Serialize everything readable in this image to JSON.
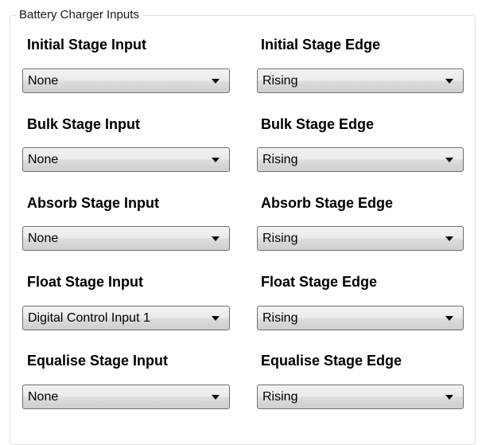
{
  "group": {
    "title": "Battery Charger Inputs"
  },
  "rows": [
    {
      "input_label": "Initial Stage Input",
      "input_value": "None",
      "edge_label": "Initial Stage Edge",
      "edge_value": "Rising"
    },
    {
      "input_label": "Bulk Stage Input",
      "input_value": "None",
      "edge_label": "Bulk Stage Edge",
      "edge_value": "Rising"
    },
    {
      "input_label": "Absorb Stage Input",
      "input_value": "None",
      "edge_label": "Absorb Stage Edge",
      "edge_value": "Rising"
    },
    {
      "input_label": "Float Stage Input",
      "input_value": "Digital Control Input 1",
      "edge_label": "Float Stage Edge",
      "edge_value": "Rising"
    },
    {
      "input_label": "Equalise Stage Input",
      "input_value": "None",
      "edge_label": "Equalise Stage Edge",
      "edge_value": "Rising"
    }
  ],
  "icons": {
    "dropdown": "chevron-down-icon"
  }
}
